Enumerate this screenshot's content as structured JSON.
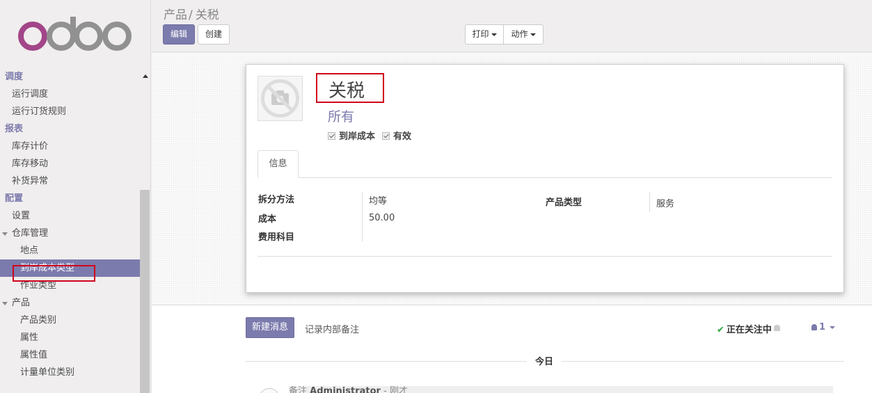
{
  "brand": {
    "logo_text": "odoo"
  },
  "sidebar": {
    "sections": [
      {
        "label": "调度",
        "items": [
          {
            "label": "运行调度"
          },
          {
            "label": "运行订货规则"
          }
        ]
      },
      {
        "label": "报表",
        "items": [
          {
            "label": "库存计价"
          },
          {
            "label": "库存移动"
          },
          {
            "label": "补货异常"
          }
        ]
      },
      {
        "label": "配置",
        "items": [
          {
            "label": "设置"
          },
          {
            "label": "仓库管理",
            "expanded": true,
            "children": [
              {
                "label": "地点"
              },
              {
                "label": "到岸成本类型",
                "active": true
              },
              {
                "label": "作业类型"
              }
            ]
          },
          {
            "label": "产品",
            "expanded": true,
            "children": [
              {
                "label": "产品类别"
              },
              {
                "label": "属性"
              },
              {
                "label": "属性值"
              },
              {
                "label": "计量单位类别"
              }
            ]
          }
        ]
      }
    ]
  },
  "breadcrumb": {
    "parent": "产品",
    "separator": "/",
    "current": "关税"
  },
  "toolbar": {
    "edit_label": "编辑",
    "create_label": "创建",
    "print_label": "打印",
    "action_label": "动作"
  },
  "form": {
    "name": "关税",
    "subtitle": "所有",
    "checkbox_landed_cost": "到岸成本",
    "checkbox_active": "有效",
    "tab_info": "信息",
    "split_method_label": "拆分方法",
    "split_method_value": "均等",
    "cost_label": "成本",
    "cost_value": "50.00",
    "expense_account_label": "费用科目",
    "product_type_label": "产品类型",
    "product_type_value": "服务"
  },
  "chatter": {
    "new_message": "新建消息",
    "log_note": "记录内部备注",
    "following": "正在关注中",
    "followers_count": "1",
    "today": "今日",
    "msg_type": "备注",
    "msg_author": "Administrator",
    "msg_dash": "-",
    "msg_time": "刚才"
  },
  "colors": {
    "accent": "#7c7bad",
    "highlight_box": "#d0021b",
    "follow_check": "#28a745"
  }
}
